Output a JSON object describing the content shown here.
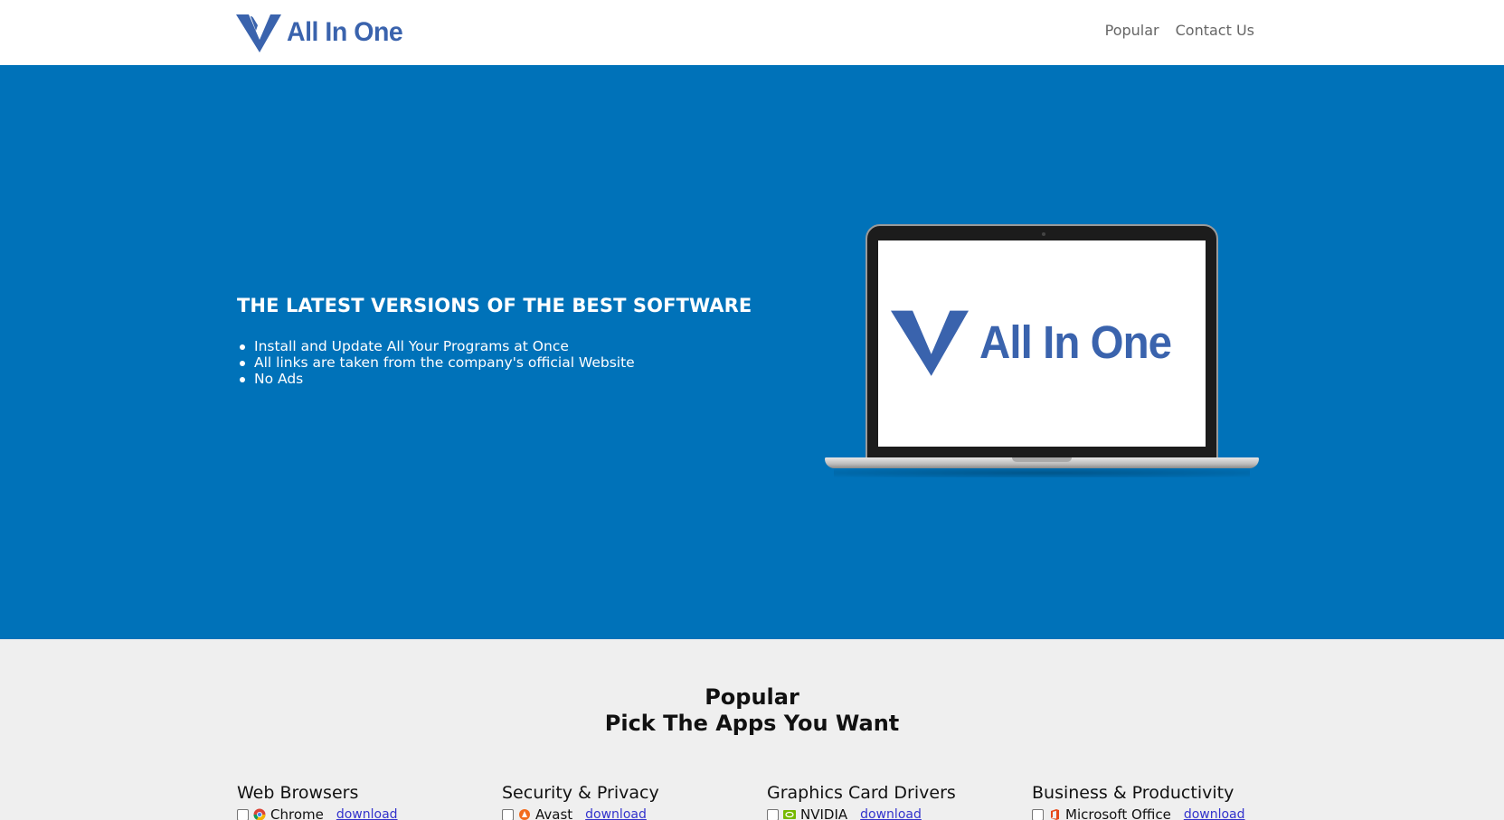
{
  "header": {
    "logo_text": "All In One",
    "nav": [
      "Popular",
      "Contact Us"
    ]
  },
  "hero": {
    "title": "THE LATEST VERSIONS OF THE BEST SOFTWARE",
    "features": [
      "Install and Update All Your Programs at Once",
      "All links are taken from the company's official Website",
      "No Ads"
    ],
    "screen_logo_text": "All In One"
  },
  "popular": {
    "heading": "Popular",
    "subheading": "Pick The Apps You Want",
    "categories": [
      {
        "title": "Web Browsers",
        "app": "Chrome",
        "icon": "chrome-icon",
        "link": "download"
      },
      {
        "title": "Security & Privacy",
        "app": "Avast",
        "icon": "avast-icon",
        "link": "download"
      },
      {
        "title": "Graphics Card Drivers",
        "app": "NVIDIA",
        "icon": "nvidia-icon",
        "link": "download"
      },
      {
        "title": "Business & Productivity",
        "app": "Microsoft Office",
        "icon": "office-icon",
        "link": "download"
      }
    ]
  },
  "colors": {
    "brand": "#3a63ad",
    "hero_bg": "#0072b9",
    "section_bg": "#efefef",
    "link": "#3333cc"
  }
}
